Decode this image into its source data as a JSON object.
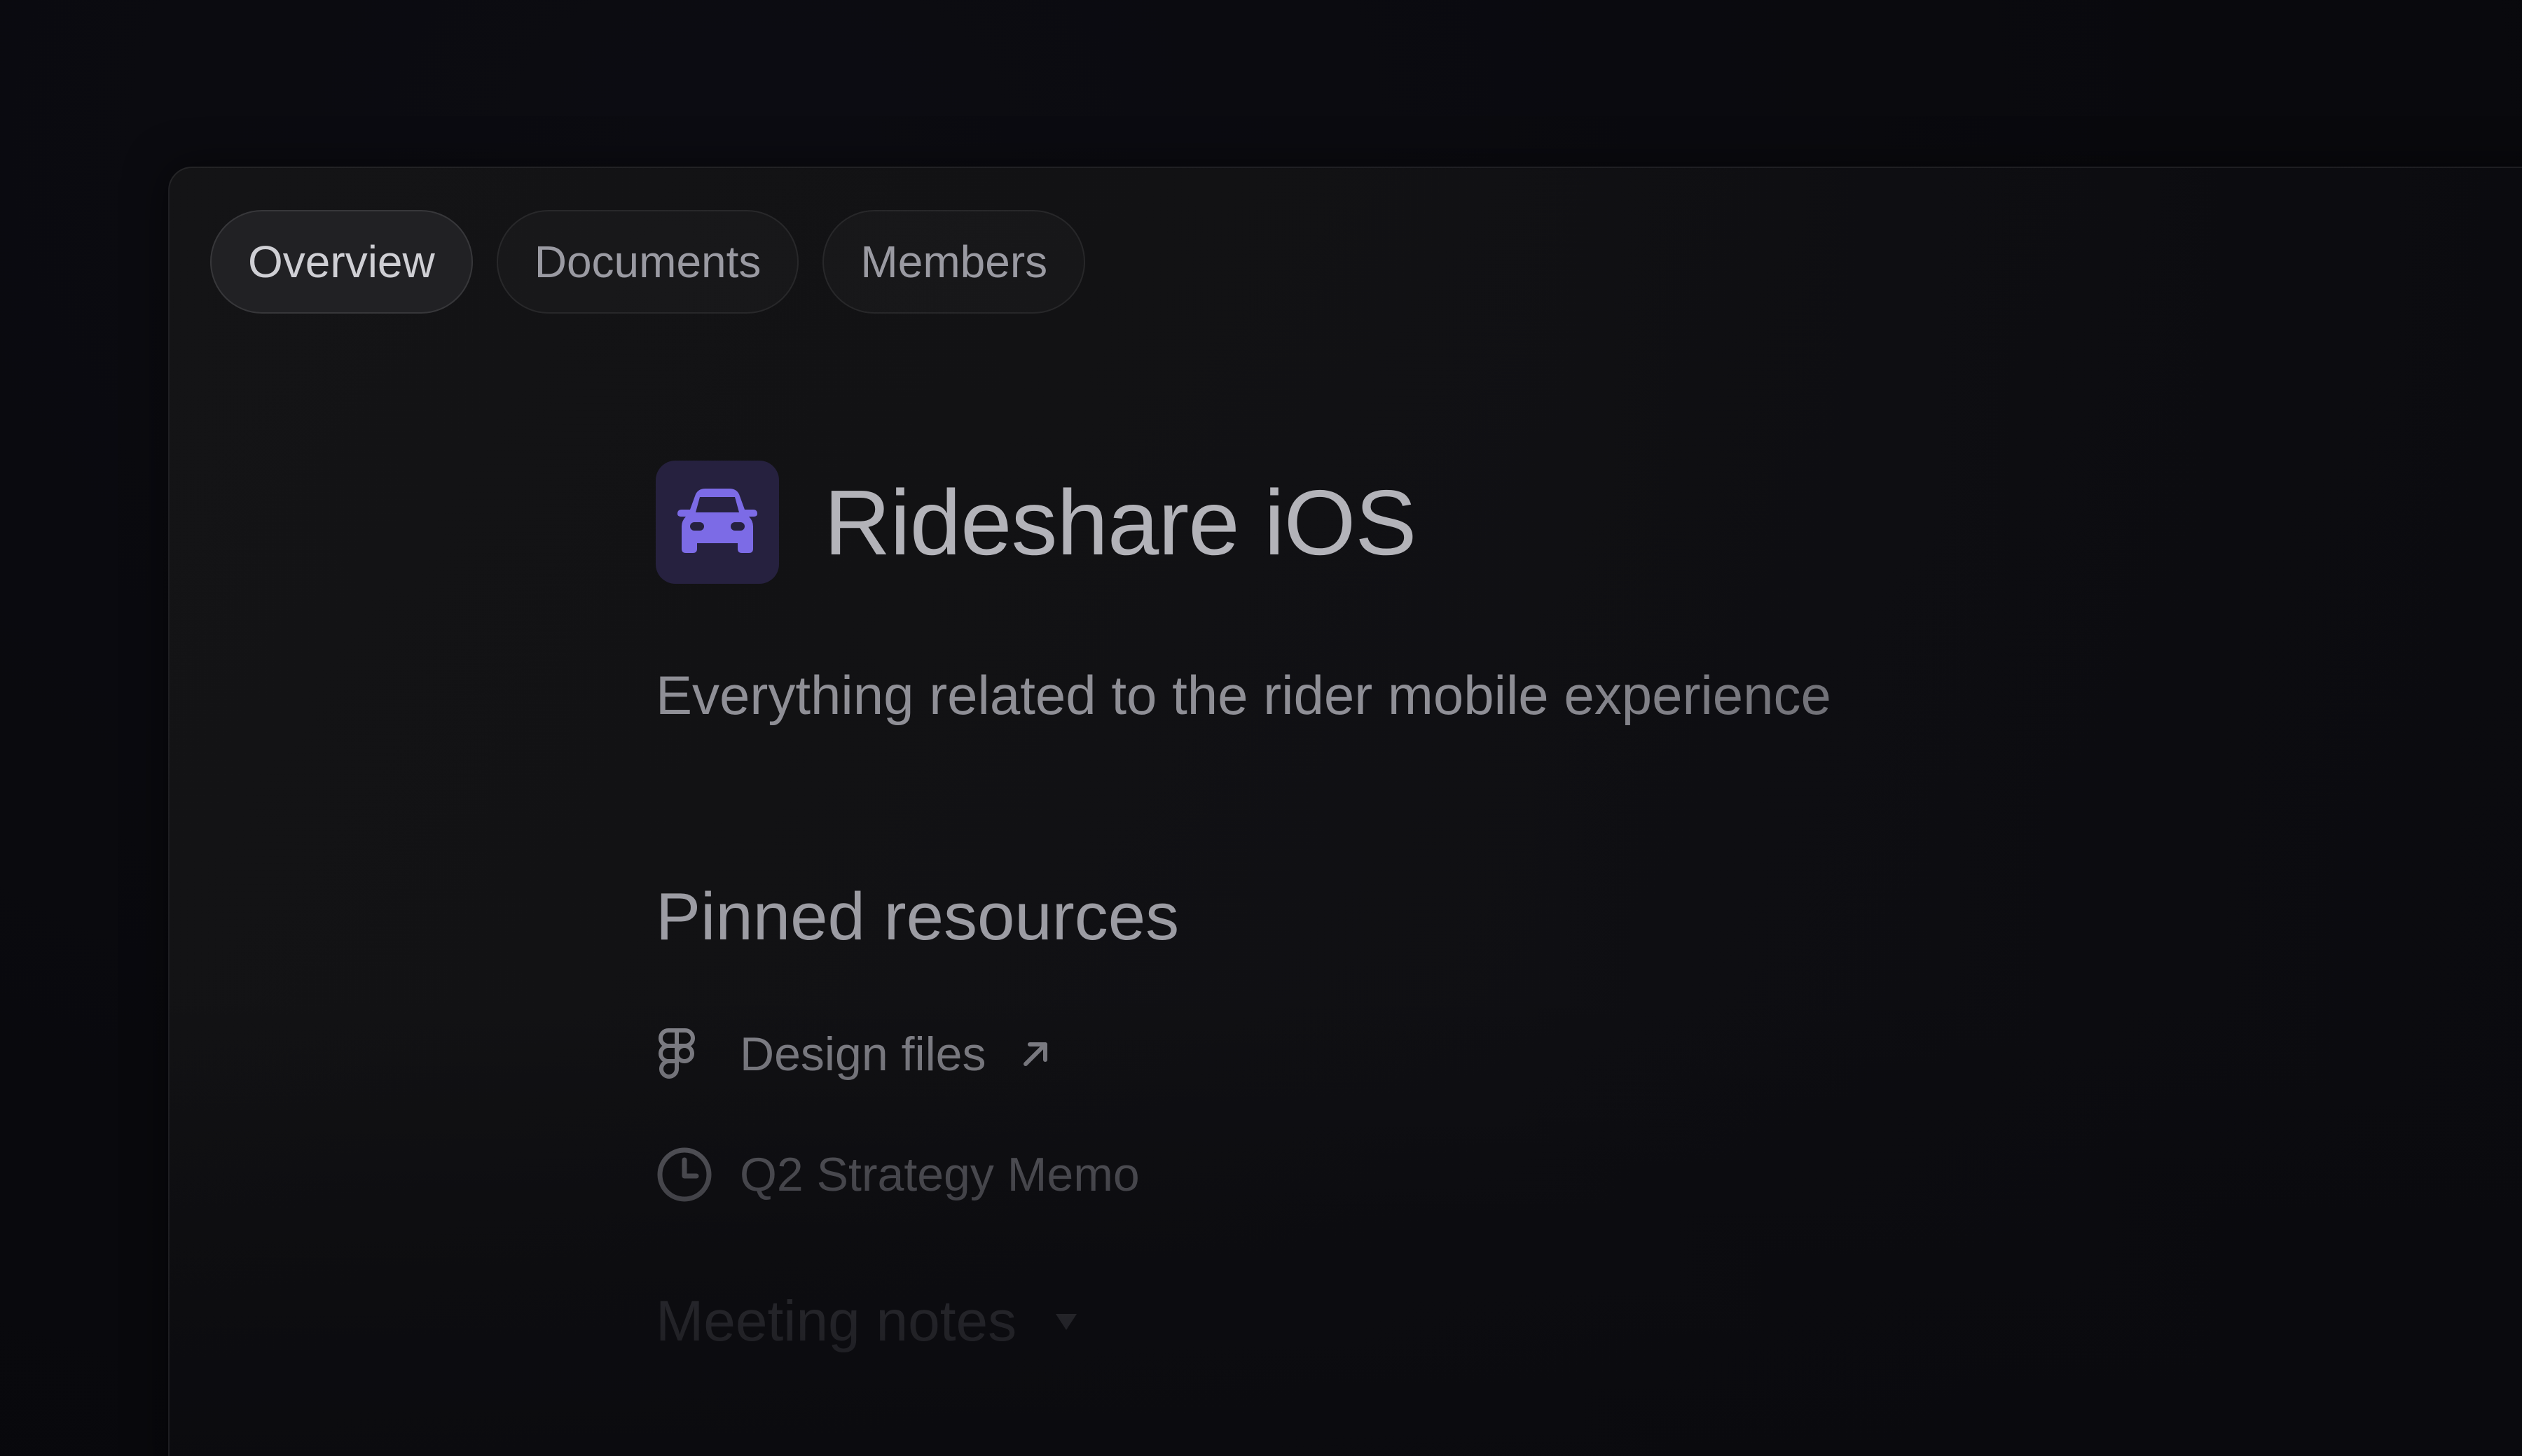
{
  "tabs": [
    {
      "label": "Overview",
      "active": true
    },
    {
      "label": "Documents",
      "active": false
    },
    {
      "label": "Members",
      "active": false
    }
  ],
  "project": {
    "title": "Rideshare iOS",
    "description": "Everything related to the rider mobile experience",
    "icon": "car-icon",
    "accent_color": "#7c6be6"
  },
  "pinned": {
    "heading": "Pinned resources",
    "items": [
      {
        "label": "Design files",
        "icon": "figma-icon",
        "external": true
      },
      {
        "label": "Q2 Strategy Memo",
        "icon": "clock-icon",
        "external": false
      }
    ]
  },
  "meeting_notes": {
    "label": "Meeting notes"
  }
}
